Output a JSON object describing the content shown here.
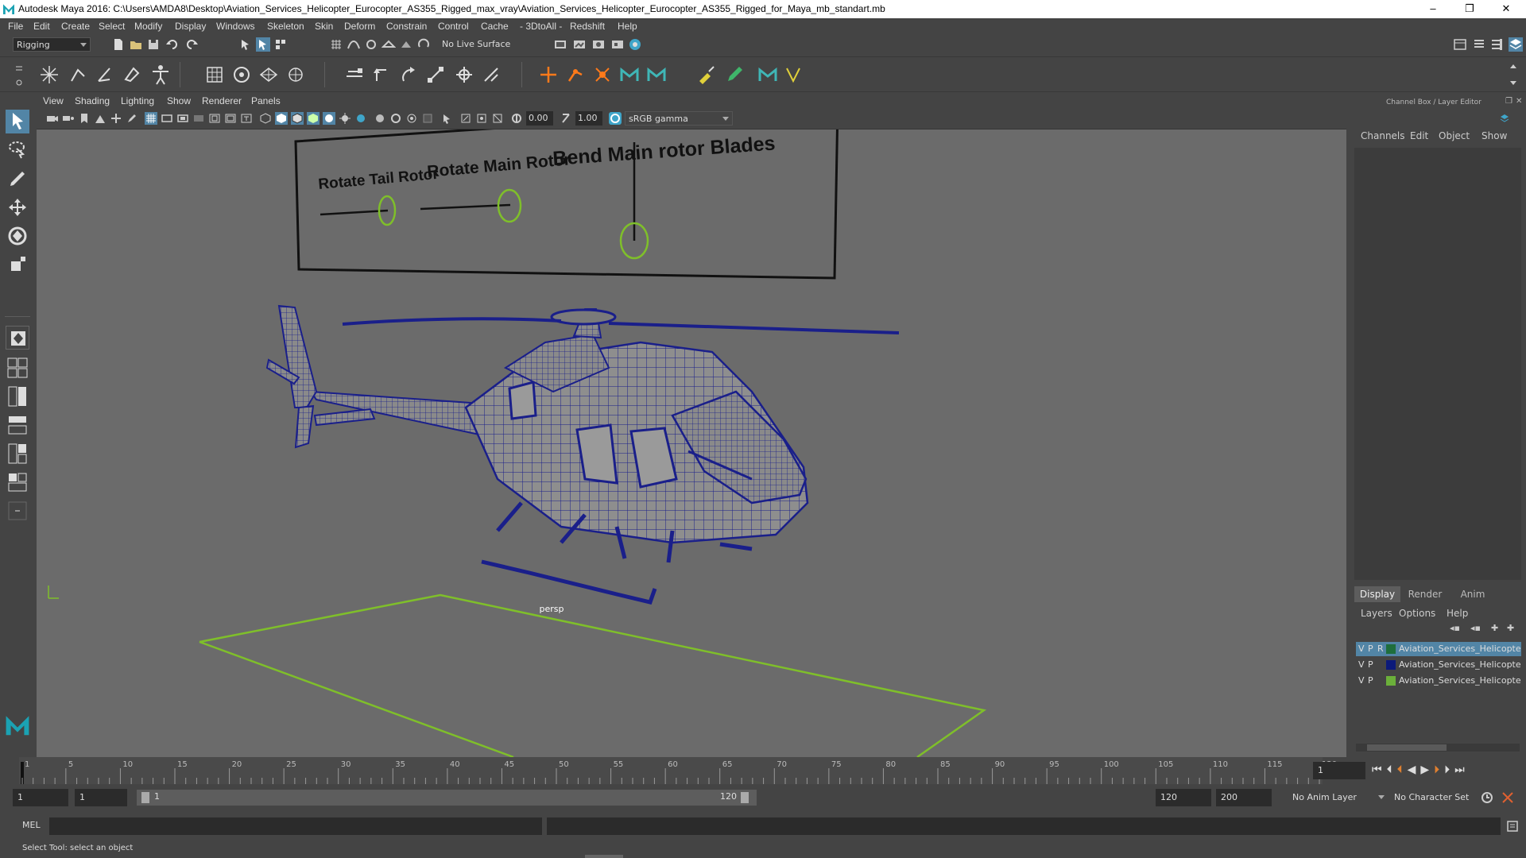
{
  "title_bar": {
    "title": "Autodesk Maya 2016: C:\\Users\\AMDA8\\Desktop\\Aviation_Services_Helicopter_Eurocopter_AS355_Rigged_max_vray\\Aviation_Services_Helicopter_Eurocopter_AS355_Rigged_for_Maya_mb_standart.mb",
    "minimize": "–",
    "restore": "❐",
    "close": "✕"
  },
  "menu": [
    "File",
    "Edit",
    "Create",
    "Select",
    "Modify",
    "Display",
    "Windows",
    "Skeleton",
    "Skin",
    "Deform",
    "Constrain",
    "Control",
    "Cache",
    "- 3DtoAll -",
    "Redshift",
    "Help"
  ],
  "status_line": {
    "menu_set": "Rigging",
    "live_surface": "No Live Surface"
  },
  "viewport": {
    "menu": [
      "View",
      "Shading",
      "Lighting",
      "Show",
      "Renderer",
      "Panels"
    ],
    "exposure": "0.00",
    "gamma": "1.00",
    "color_space": "sRGB gamma",
    "camera_label": "persp",
    "rig_labels": {
      "tail": "Rotate Tail Rotor",
      "main": "Rotate Main Rotor",
      "bend": "Bend Main rotor Blades"
    }
  },
  "channel_box": {
    "title": "Channel Box / Layer Editor",
    "menu": [
      "Channels",
      "Edit",
      "Object",
      "Show"
    ]
  },
  "layer_editor": {
    "tabs": [
      "Display",
      "Render",
      "Anim"
    ],
    "menu": [
      "Layers",
      "Options",
      "Help"
    ],
    "layers": [
      {
        "v": "V",
        "p": "P",
        "r": "R",
        "name": "Aviation_Services_Helicopter",
        "color": "#1e6e3c",
        "selected": true
      },
      {
        "v": "V",
        "p": "P",
        "r": "",
        "name": "Aviation_Services_Helicopter",
        "color": "#0c1a7a",
        "selected": false
      },
      {
        "v": "V",
        "p": "P",
        "r": "",
        "name": "Aviation_Services_Helicopter",
        "color": "#6bb03a",
        "selected": false
      }
    ]
  },
  "timeline": {
    "ticks": [
      "1",
      "5",
      "10",
      "15",
      "20",
      "25",
      "30",
      "35",
      "40",
      "45",
      "50",
      "55",
      "60",
      "65",
      "70",
      "75",
      "80",
      "85",
      "90",
      "95",
      "100",
      "105",
      "110",
      "115",
      "120"
    ],
    "current_frame": "1"
  },
  "range": {
    "start": "1",
    "playback_start": "1",
    "range_start": "1",
    "range_end": "120",
    "playback_end": "120",
    "end": "200",
    "anim_layer": "No Anim Layer",
    "character_set": "No Character Set"
  },
  "command_line": {
    "label": "MEL"
  },
  "help_line": {
    "text": "Select Tool: select an object"
  },
  "colors": {
    "ui_bg": "#444444",
    "viewport_bg": "#6b6b6b",
    "wire": "#1a1f8a",
    "grid": "#7fbf2a",
    "selection": "#5285a6"
  }
}
